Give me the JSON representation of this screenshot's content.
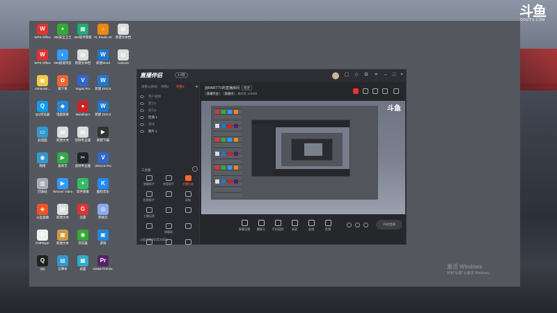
{
  "watermark": {
    "mark": "斗鱼",
    "url": "DOUYU.COM"
  },
  "desktop": {
    "icons": [
      {
        "label": "WPS Office",
        "glyph": "W",
        "color": "#d33"
      },
      {
        "label": "360安全卫士",
        "glyph": "+",
        "color": "#3a3"
      },
      {
        "label": "360软件管家",
        "glyph": "▦",
        "color": "#2a7"
      },
      {
        "label": "FL Studio 20",
        "glyph": "♪",
        "color": "#e81"
      },
      {
        "label": "新建文本档",
        "glyph": "▤",
        "color": "#ddd"
      },
      {
        "label": "WPS Office",
        "glyph": "W",
        "color": "#d33"
      },
      {
        "label": "360极速浏览",
        "glyph": "◐",
        "color": "#39f"
      },
      {
        "label": "新建文本档",
        "glyph": "▤",
        "color": "#ddd"
      },
      {
        "label": "新建Word",
        "glyph": "W",
        "color": "#27c"
      },
      {
        "label": "Cartoon",
        "glyph": "▤",
        "color": "#ddd"
      },
      {
        "label": "Administr...",
        "glyph": "▣",
        "color": "#ec4"
      },
      {
        "label": "稿下来",
        "glyph": "✿",
        "color": "#e63"
      },
      {
        "label": "Vegas Pro",
        "glyph": "V",
        "color": "#36c"
      },
      {
        "label": "新建 DOCX",
        "glyph": "W",
        "color": "#27c"
      },
      {
        "label": "",
        "glyph": "",
        "color": "transparent"
      },
      {
        "label": "QQ浏览器",
        "glyph": "Q",
        "color": "#19e"
      },
      {
        "label": "电脑管家",
        "glyph": "◆",
        "color": "#28d"
      },
      {
        "label": "Bandicam",
        "glyph": "●",
        "color": "#c22"
      },
      {
        "label": "新建 DOCX",
        "glyph": "W",
        "color": "#27c"
      },
      {
        "label": "",
        "glyph": "",
        "color": "transparent"
      },
      {
        "label": "此电脑",
        "glyph": "▭",
        "color": "#39c"
      },
      {
        "label": "新建文本",
        "glyph": "▤",
        "color": "#ddd"
      },
      {
        "label": "剪映专业版",
        "glyph": "▤",
        "color": "#ddd"
      },
      {
        "label": "新建下载",
        "glyph": "▶",
        "color": "#333"
      },
      {
        "label": "",
        "glyph": "",
        "color": "transparent"
      },
      {
        "label": "网络",
        "glyph": "◉",
        "color": "#39c"
      },
      {
        "label": "爱奇艺",
        "glyph": "▶",
        "color": "#3a4"
      },
      {
        "label": "剪映专业版",
        "glyph": "✂",
        "color": "#222"
      },
      {
        "label": "VEGAS Pro",
        "glyph": "V",
        "color": "#36c"
      },
      {
        "label": "",
        "glyph": "",
        "color": "transparent"
      },
      {
        "label": "回收站",
        "glyph": "▥",
        "color": "#aab"
      },
      {
        "label": "Tencent Video",
        "glyph": "▶",
        "color": "#39f"
      },
      {
        "label": "软件管家",
        "glyph": "✦",
        "color": "#3b6"
      },
      {
        "label": "酷狗音乐",
        "glyph": "K",
        "color": "#28f"
      },
      {
        "label": "",
        "glyph": "",
        "color": "transparent"
      },
      {
        "label": "斗鱼直播",
        "glyph": "◈",
        "color": "#e52"
      },
      {
        "label": "新建文本",
        "glyph": "▤",
        "color": "#ddd"
      },
      {
        "label": "迅雷",
        "glyph": "G",
        "color": "#d33"
      },
      {
        "label": "网易云",
        "glyph": "◎",
        "color": "#8ae"
      },
      {
        "label": "",
        "glyph": "",
        "color": "transparent"
      },
      {
        "label": "PotPlayer",
        "glyph": "P",
        "color": "#eee"
      },
      {
        "label": "新建文本",
        "glyph": "▦",
        "color": "#c94"
      },
      {
        "label": "浏览器",
        "glyph": "◉",
        "color": "#3a3"
      },
      {
        "label": "游戏",
        "glyph": "▣",
        "color": "#28d"
      },
      {
        "label": "",
        "glyph": "",
        "color": "transparent"
      },
      {
        "label": "QQ",
        "glyph": "Q",
        "color": "#222"
      },
      {
        "label": "记事本",
        "glyph": "▤",
        "color": "#39c"
      },
      {
        "label": "桌面",
        "glyph": "▦",
        "color": "#3ac"
      },
      {
        "label": "Adobe Premie...",
        "glyph": "Pr",
        "color": "#526"
      }
    ],
    "activate": {
      "line1": "激活 Windows",
      "line2": "转到\"设置\"以激活 Windows。"
    }
  },
  "app": {
    "brand": "直播伴侣",
    "version": "3.0版",
    "tabs": [
      "场景1(测试)",
      "场景2",
      "场景3"
    ],
    "tab_add": "+",
    "sources": [
      "用户视频",
      "窗口1",
      "窗口2",
      "检测 1",
      "游戏",
      "图片 1"
    ],
    "tools_title": "工具箱",
    "tools": [
      "弹幕助手",
      "房管助手",
      "主播任务",
      "投票助手",
      "",
      "录制",
      "主播运营",
      "",
      "",
      "",
      "弹幕姬",
      "",
      "",
      "",
      ""
    ],
    "footer": "斗鱼直播伴侣官方网站",
    "room_title": "@RARTTV的直播房间",
    "room_tag": "修改",
    "room_meta": {
      "badge1": "直播平台",
      "badge2": "直播中",
      "text": "房间号 123456"
    },
    "preview_watermark": "斗鱼",
    "toolbar": [
      "直播设置",
      "摄像头",
      "手机投屏",
      "录屏",
      "连线",
      "音频"
    ],
    "start_button": "开始直播"
  }
}
